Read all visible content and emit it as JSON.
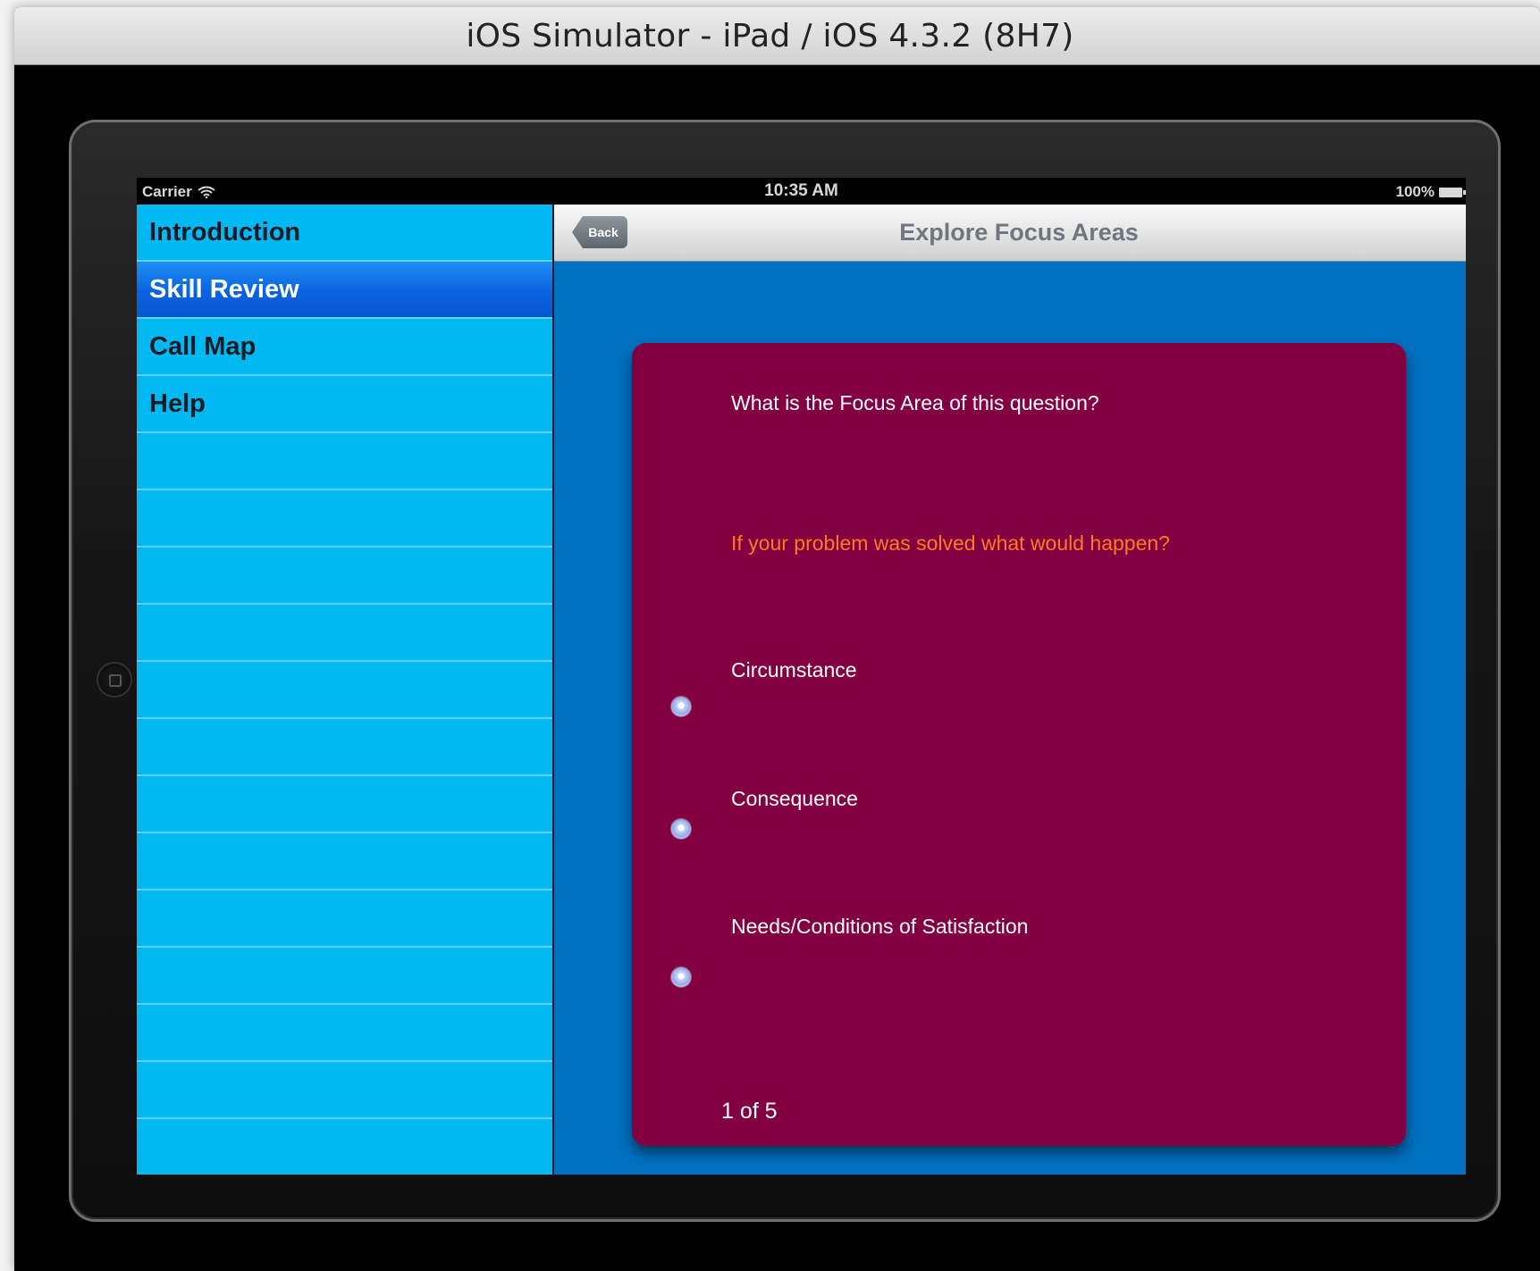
{
  "window": {
    "title": "iOS Simulator - iPad / iOS 4.3.2 (8H7)"
  },
  "statusbar": {
    "carrier": "Carrier",
    "time": "10:35 AM",
    "battery": "100%"
  },
  "sidebar": {
    "items": [
      {
        "label": "Introduction",
        "selected": false
      },
      {
        "label": "Skill Review",
        "selected": true
      },
      {
        "label": "Call Map",
        "selected": false
      },
      {
        "label": "Help",
        "selected": false
      }
    ],
    "empty_rows": 13
  },
  "navbar": {
    "back_label": "Back",
    "title": "Explore Focus Areas"
  },
  "quiz": {
    "prompt": "What is the Focus Area of this question?",
    "question": "If your problem was solved what would happen?",
    "options": [
      {
        "label": "Circumstance"
      },
      {
        "label": "Consequence"
      },
      {
        "label": "Needs/Conditions of Satisfaction"
      }
    ],
    "progress": "1 of 5"
  },
  "colors": {
    "sidebar_bg": "#00b9f3",
    "sidebar_selected": "#0a62e0",
    "detail_bg": "#0070c0",
    "card_bg": "#820041",
    "question_text": "#ff7a20"
  }
}
